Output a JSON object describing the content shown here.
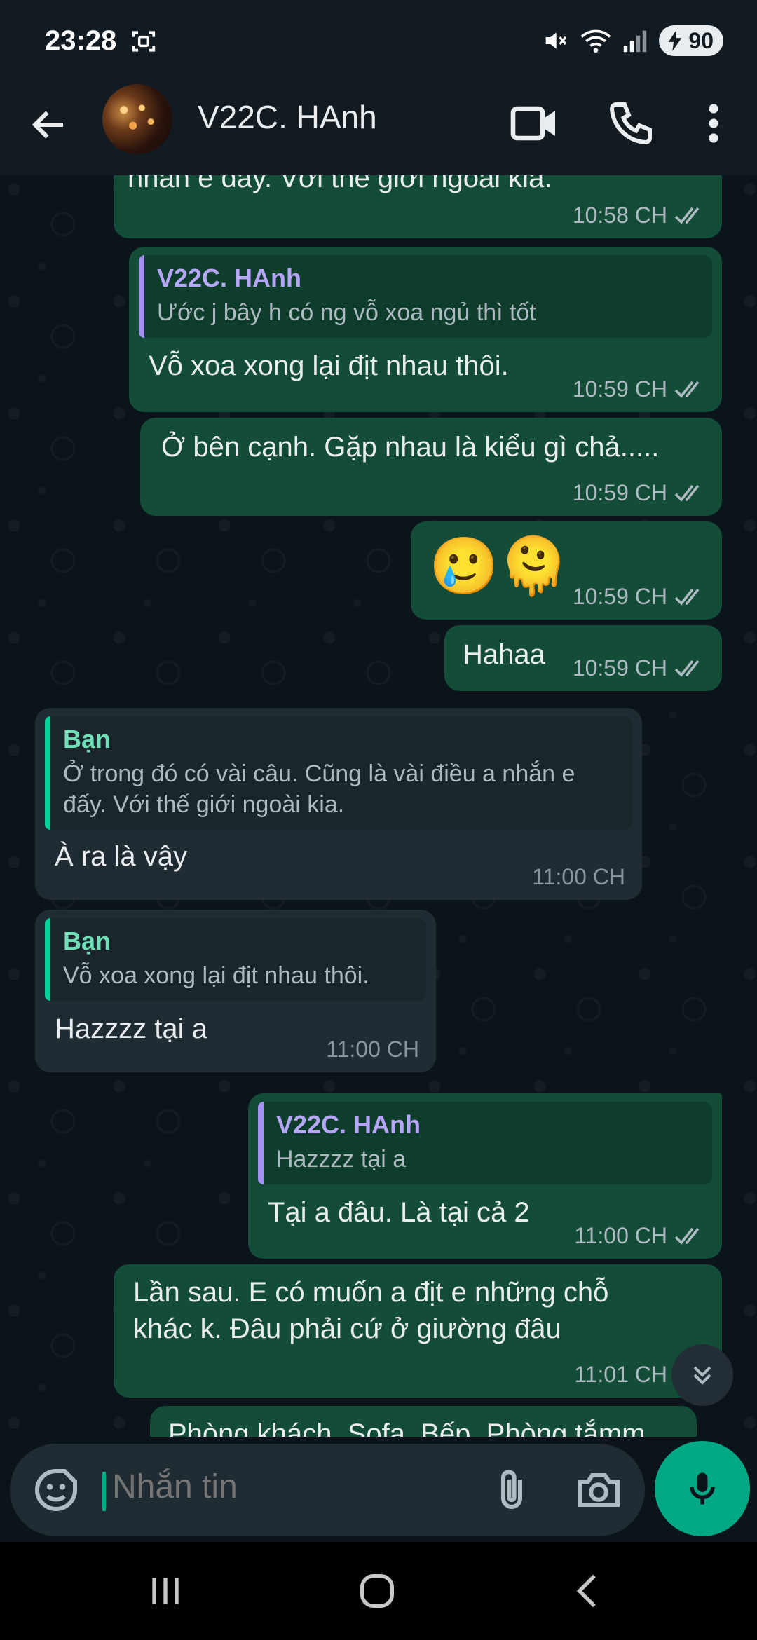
{
  "status_bar": {
    "time": "23:28",
    "battery": "90"
  },
  "header": {
    "contact_name": "V22C. HAnh"
  },
  "messages": [
    {
      "text": "nhắn e đấy. Với thế giới ngoài kia.",
      "time": "10:58 CH"
    },
    {
      "quote_name": "V22C. HAnh",
      "quote_text": "Ước j bây h có ng vỗ xoa ngủ thì tốt",
      "text": "Vỗ xoa xong lại địt nhau thôi.",
      "time": "10:59 CH"
    },
    {
      "text": "Ở bên cạnh. Gặp nhau là kiểu gì chả.....",
      "time": "10:59 CH"
    },
    {
      "text": "🥲🫠",
      "time": "10:59 CH"
    },
    {
      "text": "Hahaa",
      "time": "10:59 CH"
    },
    {
      "quote_name": "Bạn",
      "quote_text": "Ở trong đó có vài câu. Cũng là vài điều a nhắn e đấy. Với thế giới ngoài kia.",
      "text": "À ra là vậy",
      "time": "11:00 CH"
    },
    {
      "quote_name": "Bạn",
      "quote_text": "Vỗ xoa xong lại địt nhau thôi.",
      "text": "Hazzzz tại a",
      "time": "11:00 CH"
    },
    {
      "quote_name": "V22C. HAnh",
      "quote_text": "Hazzzz tại a",
      "text": "Tại a đâu. Là tại cả 2",
      "time": "11:00 CH"
    },
    {
      "text": "Lần sau. E có muốn a địt e những chỗ khác k. Đâu phải cứ ở giường đâu",
      "time": "11:01 CH"
    },
    {
      "text": "Phòng khách. Sofa. Bếp. Phòng tắmm"
    }
  ],
  "input": {
    "placeholder": "Nhắn tin"
  },
  "colors": {
    "outgoing_bubble": "#144d37",
    "incoming_bubble": "#1f2c34",
    "accent": "#00a884",
    "background": "#0b141a"
  }
}
